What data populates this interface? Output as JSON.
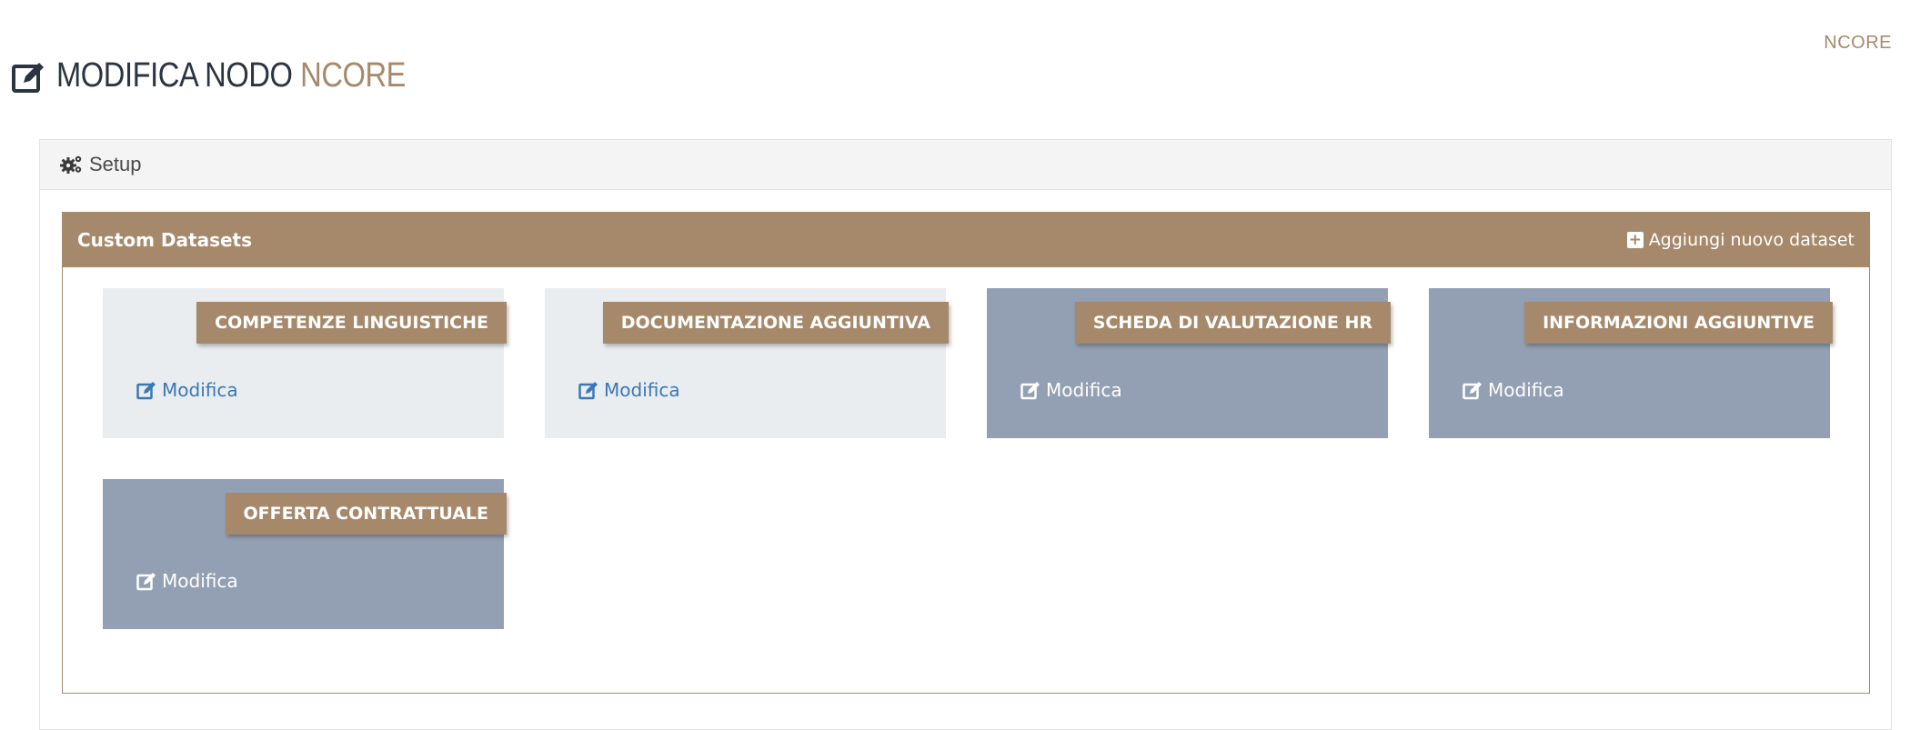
{
  "brand": {
    "top_right": "NCORE"
  },
  "header": {
    "title_main": "MODIFICA NODO",
    "title_accent": "NCORE",
    "icon": "edit-icon"
  },
  "setup": {
    "label": "Setup",
    "icon": "gears-icon"
  },
  "datasets": {
    "title": "Custom Datasets",
    "add_label": "Aggiungi nuovo dataset",
    "tiles": [
      {
        "name": "COMPETENZE LINGUISTICHE",
        "edit_label": "Modifica",
        "style": "light"
      },
      {
        "name": "DOCUMENTAZIONE AGGIUNTIVA",
        "edit_label": "Modifica",
        "style": "light"
      },
      {
        "name": "SCHEDA DI VALUTAZIONE HR",
        "edit_label": "Modifica",
        "style": "dark"
      },
      {
        "name": "INFORMAZIONI AGGIUNTIVE",
        "edit_label": "Modifica",
        "style": "dark"
      },
      {
        "name": "OFFERTA CONTRATTUALE",
        "edit_label": "Modifica",
        "style": "dark"
      }
    ]
  },
  "colors": {
    "accent": "#a6896a",
    "tile_light": "#e9edf0",
    "tile_dark": "#93a0b3",
    "link": "#3a78b5"
  }
}
